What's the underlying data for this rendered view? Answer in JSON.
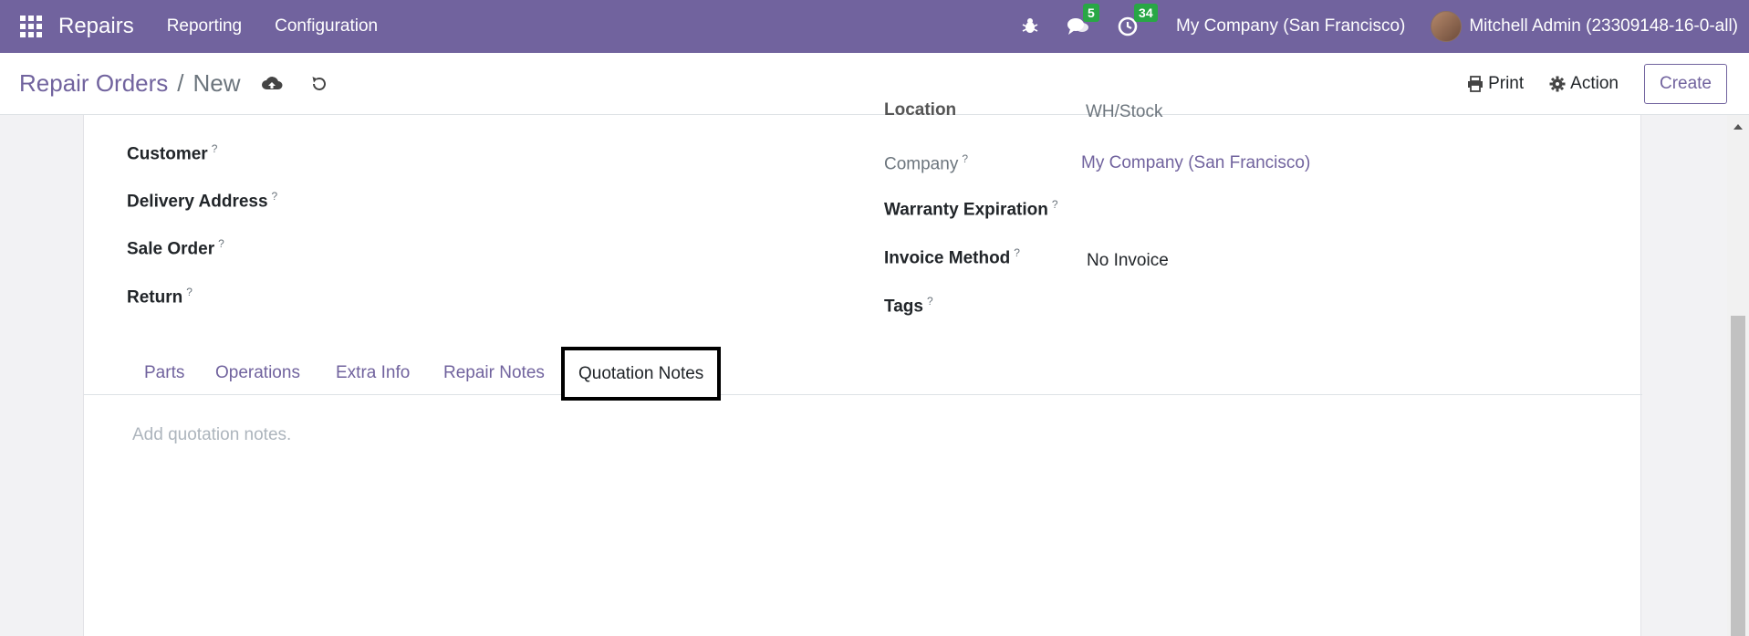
{
  "navbar": {
    "brand": "Repairs",
    "menu": [
      "Reporting",
      "Configuration"
    ],
    "messages_count": "5",
    "activities_count": "34",
    "company": "My Company (San Francisco)",
    "user": "Mitchell Admin (23309148-16-0-all)"
  },
  "control": {
    "breadcrumb_parent": "Repair Orders",
    "breadcrumb_sep": "/",
    "breadcrumb_current": "New",
    "print_label": "Print",
    "action_label": "Action",
    "create_label": "Create"
  },
  "form": {
    "left_fields": [
      {
        "label": "Customer",
        "help": "?"
      },
      {
        "label": "Delivery Address",
        "help": "?"
      },
      {
        "label": "Sale Order",
        "help": "?"
      },
      {
        "label": "Return",
        "help": "?"
      }
    ],
    "location_label_cut": "Location",
    "location_value_cut": "WH/Stock",
    "company_label": "Company",
    "company_value": "My Company (San Francisco)",
    "warranty_label": "Warranty Expiration",
    "invoice_label": "Invoice Method",
    "invoice_value": "No Invoice",
    "tags_label": "Tags",
    "help_mark": "?"
  },
  "tabs": [
    "Parts",
    "Operations",
    "Extra Info",
    "Repair Notes",
    "Quotation Notes"
  ],
  "active_tab": "Quotation Notes",
  "notes_placeholder": "Add quotation notes."
}
